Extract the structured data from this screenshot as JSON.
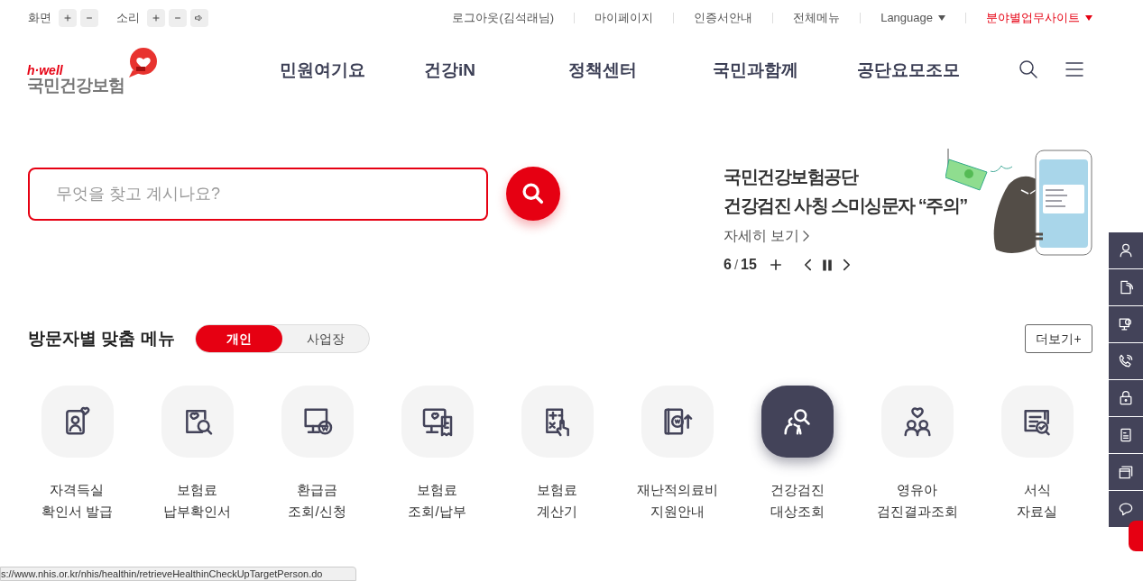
{
  "top_bar": {
    "controls": [
      {
        "label": "화면",
        "sound": false
      },
      {
        "label": "소리",
        "sound": true
      }
    ],
    "links": [
      {
        "label": "로그아웃(김석래님)",
        "kind": "link",
        "highlighted": false
      },
      {
        "label": "마이페이지",
        "kind": "link",
        "highlighted": false
      },
      {
        "label": "인증서안내",
        "kind": "link",
        "highlighted": false
      },
      {
        "label": "전체메뉴",
        "kind": "link",
        "highlighted": false
      },
      {
        "label": "Language",
        "kind": "dropdown",
        "highlighted": false
      },
      {
        "label": "분야별업무사이트",
        "kind": "dropdown",
        "highlighted": true
      }
    ]
  },
  "header": {
    "logo": {
      "tagline": "h·well",
      "name": "국민건강보험"
    },
    "nav": [
      "민원여기요",
      "건강iN",
      "정책센터",
      "국민과함께",
      "공단요모조모"
    ]
  },
  "search": {
    "placeholder": "무엇을 찾고 계시나요?"
  },
  "banner": {
    "title_lines": [
      "국민건강보험공단",
      "건강검진 사칭 스미싱문자 “주의”"
    ],
    "link": "자세히 보기",
    "current": "6",
    "separator": "/",
    "total": "15"
  },
  "visitor_menu": {
    "title": "방문자별 맞춤 메뉴",
    "tabs": [
      {
        "label": "개인",
        "selected": true
      },
      {
        "label": "사업장",
        "selected": false
      }
    ],
    "more": "더보기+",
    "items": [
      {
        "lines": [
          "자격득실",
          "확인서 발급"
        ],
        "selected": false
      },
      {
        "lines": [
          "보험료",
          "납부확인서"
        ],
        "selected": false
      },
      {
        "lines": [
          "환급금",
          "조회/신청"
        ],
        "selected": false
      },
      {
        "lines": [
          "보험료",
          "조회/납부"
        ],
        "selected": false
      },
      {
        "lines": [
          "보험료",
          "계산기"
        ],
        "selected": false
      },
      {
        "lines": [
          "재난적의료비",
          "지원안내"
        ],
        "selected": false
      },
      {
        "lines": [
          "건강검진",
          "대상조회"
        ],
        "selected": true
      },
      {
        "lines": [
          "영유아",
          "검진결과조회"
        ],
        "selected": false
      },
      {
        "lines": [
          "서식",
          "자료실"
        ],
        "selected": false
      }
    ]
  },
  "status_url": "s://www.nhis.or.kr/nhis/healthin/retrieveHealthinCheckUpTargetPerson.do"
}
